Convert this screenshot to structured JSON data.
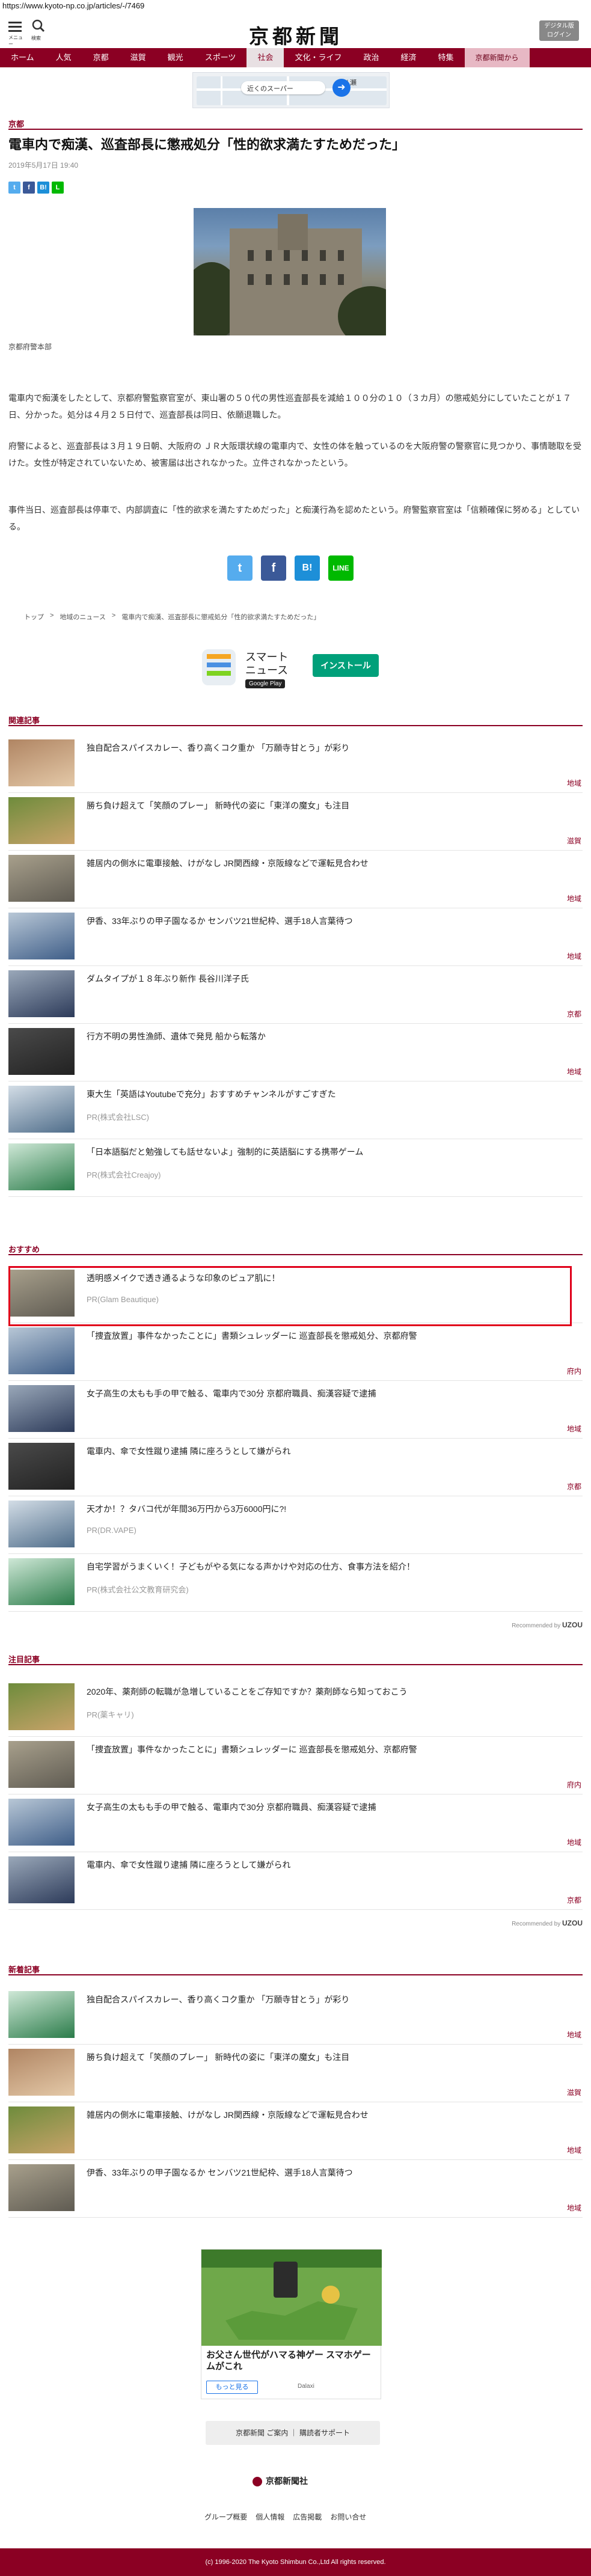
{
  "browser": {
    "url": "https://www.kyoto-np.co.jp/articles/-/7469"
  },
  "header": {
    "menu_label": "メニュー",
    "search_label": "検索",
    "logo_text": "京都新聞",
    "digital_label_1": "デジタル版",
    "digital_label_2": "ログイン"
  },
  "nav": {
    "items": [
      "ホーム",
      "人気",
      "京都",
      "滋賀",
      "観光",
      "スポーツ",
      "社会",
      "文化・ライフ",
      "政治",
      "経済",
      "特集",
      "京都新聞から"
    ],
    "active": "社会"
  },
  "top_ad": {
    "place": "八瀬",
    "pill": "近くのスーパー",
    "label": "広告"
  },
  "article": {
    "category": "京都",
    "title": "電車内で痴漢、巡査部長に懲戒処分「性的欲求満たすためだった」",
    "date": "2019年5月17日 19:40",
    "photo_caption": "京都府警本部",
    "paragraphs": [
      "電車内で痴漢をしたとして、京都府警監察官室が、東山署の５０代の男性巡査部長を減給１００分の１０（３カ月）の懲戒処分にしていたことが１７日、分かった。処分は４月２５日付で、巡査部長は同日、依願退職した。",
      "府警によると、巡査部長は３月１９日朝、大阪府の ＪＲ大阪環状線の電車内で、女性の体を触っているのを大阪府警の警察官に見つかり、事情聴取を受けた。女性が特定されていないため、被害届は出されなかった。立件されなかったという。",
      "事件当日、巡査部長は停車で、内部調査に「性的欲求を満たすためだった」と痴漢行為を認めたという。府警監察官室は「信頼確保に努める」としている。"
    ]
  },
  "share": {
    "small": [
      "t",
      "f",
      "B!",
      "L"
    ],
    "big": [
      "t",
      "f",
      "B!",
      "LINE"
    ]
  },
  "breadcrumb": [
    "トップ",
    "地域のニュース",
    "電車内で痴漢、巡査部長に懲戒処分「性的欲求満たすためだった」"
  ],
  "app_banner": {
    "name": "スマート\nニュース",
    "store": "Google Play",
    "install": "インストール"
  },
  "sections": {
    "related": "関連記事",
    "recommend": "おすすめ",
    "featured": "注目記事",
    "latest": "新着記事"
  },
  "related": [
    {
      "title": "独自配合スパイスカレー、香り高くコク重か 「万願寺甘とう」が彩り",
      "cat": "地域"
    },
    {
      "title": "勝ち負け超えて「笑顔のプレー」 新時代の姿に「東洋の魔女」も注目",
      "cat": "滋賀"
    },
    {
      "title": "雑居内の側水に電車接触、けがなし JR関西線・京阪線などで運転見合わせ",
      "cat": "地域"
    },
    {
      "title": "伊香、33年ぶりの甲子園なるか センバツ21世紀枠、選手18人言葉待つ",
      "cat": "地域"
    },
    {
      "title": "ダムタイプが１８年ぶり新作 長谷川洋子氏",
      "cat": "京都"
    },
    {
      "title": "行方不明の男性漁師、遺体で発見 船から転落か",
      "cat": "地域"
    },
    {
      "title": "東大生「英語はYoutubeで充分」おすすめチャンネルがすごすぎた",
      "pr": "PR(株式会社LSC)"
    },
    {
      "title": "「日本語脳だと勉強しても話せないよ」強制的に英語脳にする携帯ゲーム",
      "pr": "PR(株式会社Creajoy)"
    }
  ],
  "recommend": [
    {
      "title": "透明感メイクで透き通るような印象のピュア肌に！",
      "pr": "PR(Glam Beautique)"
    },
    {
      "title": "「捜査放置」事件なかったことに」書類シュレッダーに 巡査部長を懲戒処分、京都府警",
      "cat": "府内"
    },
    {
      "title": "女子高生の太もも手の甲で触る、電車内で30分 京都府職員、痴漢容疑で逮捕",
      "cat": "地域"
    },
    {
      "title": "電車内、傘で女性蹴り逮捕 隣に座ろうとして嫌がられ",
      "cat": "京都"
    },
    {
      "title": "天才か！？タバコ代が年間36万円から3万6000円に?!",
      "pr": "PR(DR.VAPE)"
    },
    {
      "title": "自宅学習がうまくいく！子どもがやる気になる声かけや対応の仕方、食事方法を紹介！",
      "pr": "PR(株式会社公文教育研究会)"
    }
  ],
  "featured": [
    {
      "title": "2020年、薬剤師の転職が急増していることをご存知ですか？薬剤師なら知っておこう",
      "pr": "PR(薬キャリ)"
    },
    {
      "title": "「捜査放置」事件なかったことに」書類シュレッダーに 巡査部長を懲戒処分、京都府警",
      "cat": "府内"
    },
    {
      "title": "女子高生の太もも手の甲で触る、電車内で30分 京都府職員、痴漢容疑で逮捕",
      "cat": "地域"
    },
    {
      "title": "電車内、傘で女性蹴り逮捕 隣に座ろうとして嫌がられ",
      "cat": "京都"
    }
  ],
  "latest": [
    {
      "title": "独自配合スパイスカレー、香り高くコク重か 「万願寺甘とう」が彩り",
      "cat": "地域"
    },
    {
      "title": "勝ち負け超えて「笑顔のプレー」 新時代の姿に「東洋の魔女」も注目",
      "cat": "滋賀"
    },
    {
      "title": "雑居内の側水に電車接触、けがなし JR関西線・京阪線などで運転見合わせ",
      "cat": "地域"
    },
    {
      "title": "伊香、33年ぶりの甲子園なるか センバツ21世紀枠、選手18人言葉待つ",
      "cat": "地域"
    }
  ],
  "recommended_by": "Recommended by",
  "game_ad": {
    "title": "お父さん世代がハマる神ゲー スマホゲームがこれ",
    "button": "もっと見る",
    "advertiser": "Dalaxi"
  },
  "footer": {
    "links_box": "京都新聞 ご案内 ｜ 購読者サポート",
    "logo": "京都新聞社",
    "nav": [
      "グループ概要",
      "個人情報",
      "広告掲載",
      "お問い合せ"
    ],
    "copyright": "(c) 1996-2020 The Kyoto Shimbun Co.,Ltd All rights reserved."
  },
  "colors": {
    "brand": "#8b0023",
    "highlight": "#e0001a"
  }
}
